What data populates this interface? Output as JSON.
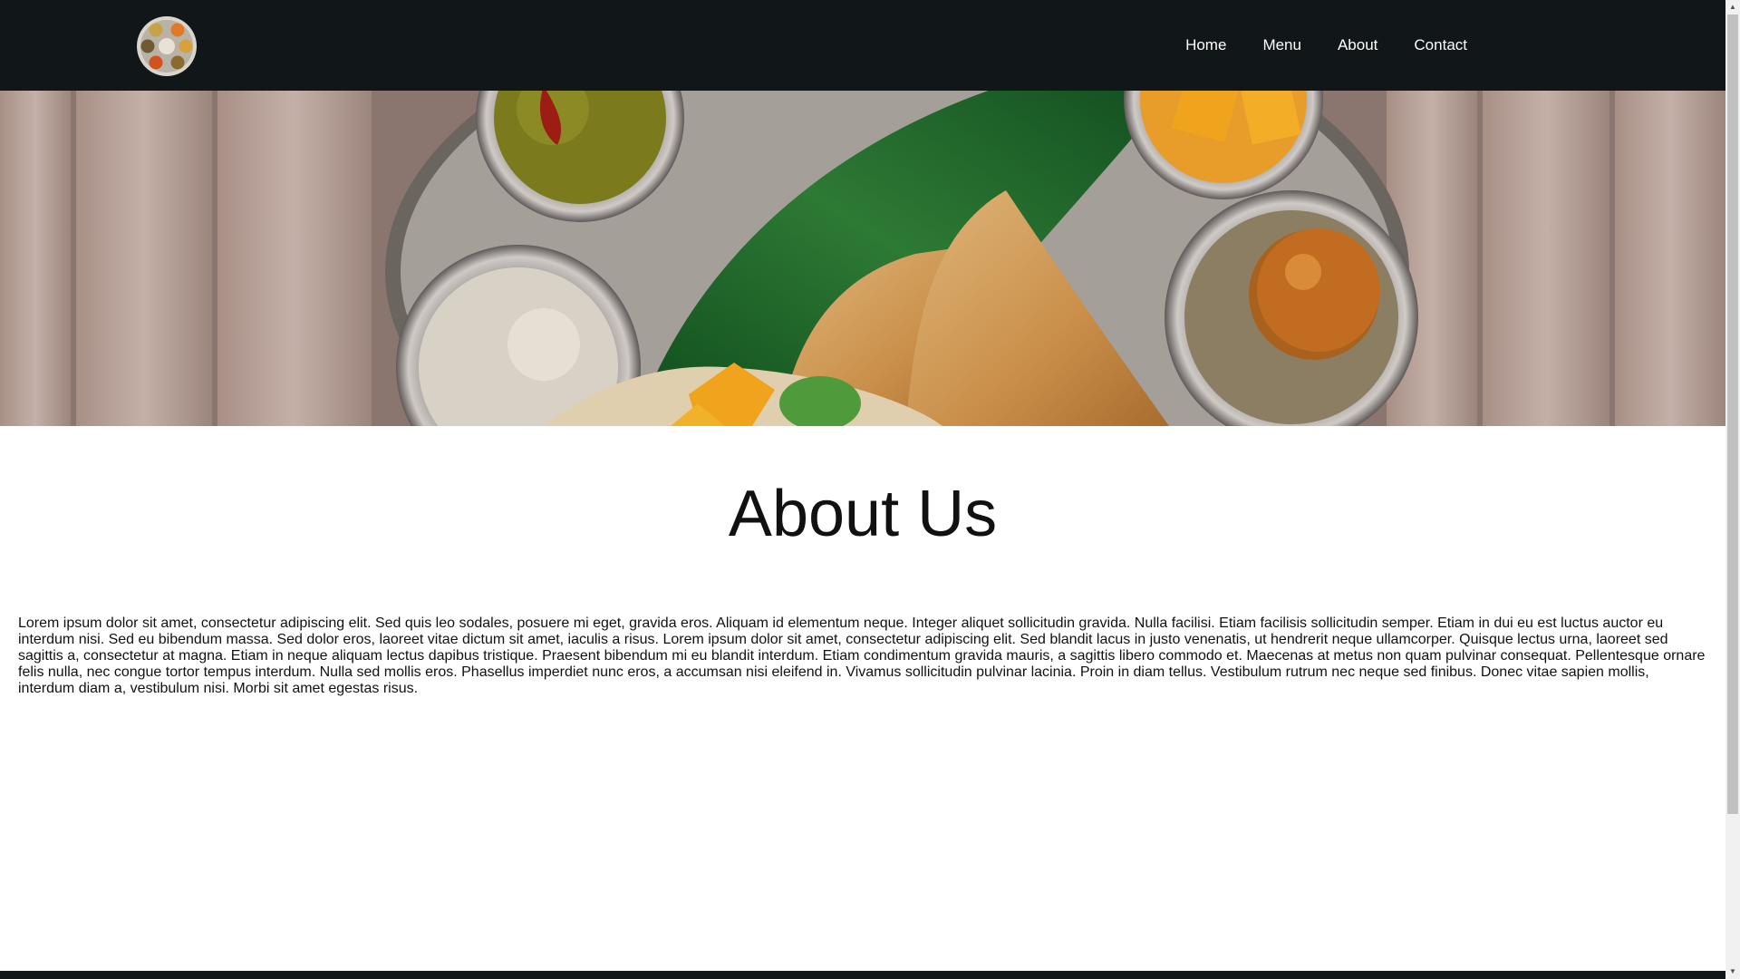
{
  "header": {
    "logo_icon": "thali-plate-logo-icon",
    "nav": [
      {
        "label": "Home"
      },
      {
        "label": "Menu"
      },
      {
        "label": "About"
      },
      {
        "label": "Contact"
      }
    ]
  },
  "hero": {
    "image": "indian-thali-dosa-banner-image"
  },
  "main": {
    "title": "About Us",
    "body": "Lorem ipsum dolor sit amet, consectetur adipiscing elit. Sed quis leo sodales, posuere mi eget, gravida eros. Aliquam id elementum neque. Integer aliquet sollicitudin gravida. Nulla facilisi. Etiam facilisis sollicitudin semper. Etiam in dui eu est luctus auctor eu interdum nisi. Sed eu bibendum massa. Sed dolor eros, laoreet vitae dictum sit amet, iaculis a risus. Lorem ipsum dolor sit amet, consectetur adipiscing elit. Sed blandit lacus in justo venenatis, ut hendrerit neque ullamcorper. Quisque lectus urna, laoreet sed sagittis a, consectetur at magna. Etiam in neque aliquam lectus dapibus tristique. Praesent bibendum mi eu blandit interdum. Etiam condimentum gravida mauris, a sagittis libero commodo et. Maecenas at metus non quam pulvinar consequat. Pellentesque ornare felis nulla, nec congue tortor tempus interdum. Nulla sed mollis eros. Phasellus imperdiet nunc eros, a accumsan nisi eleifend in. Vivamus sollicitudin pulvinar lacinia. Proin in diam tellus. Vestibulum rutrum nec neque sed finibus. Donec vitae sapien mollis, interdum diam a, vestibulum nisi. Morbi sit amet egestas risus."
  },
  "colors": {
    "navbar_bg": "#111619",
    "nav_text": "#ffffff",
    "page_bg": "#ffffff",
    "body_text": "#111111"
  }
}
